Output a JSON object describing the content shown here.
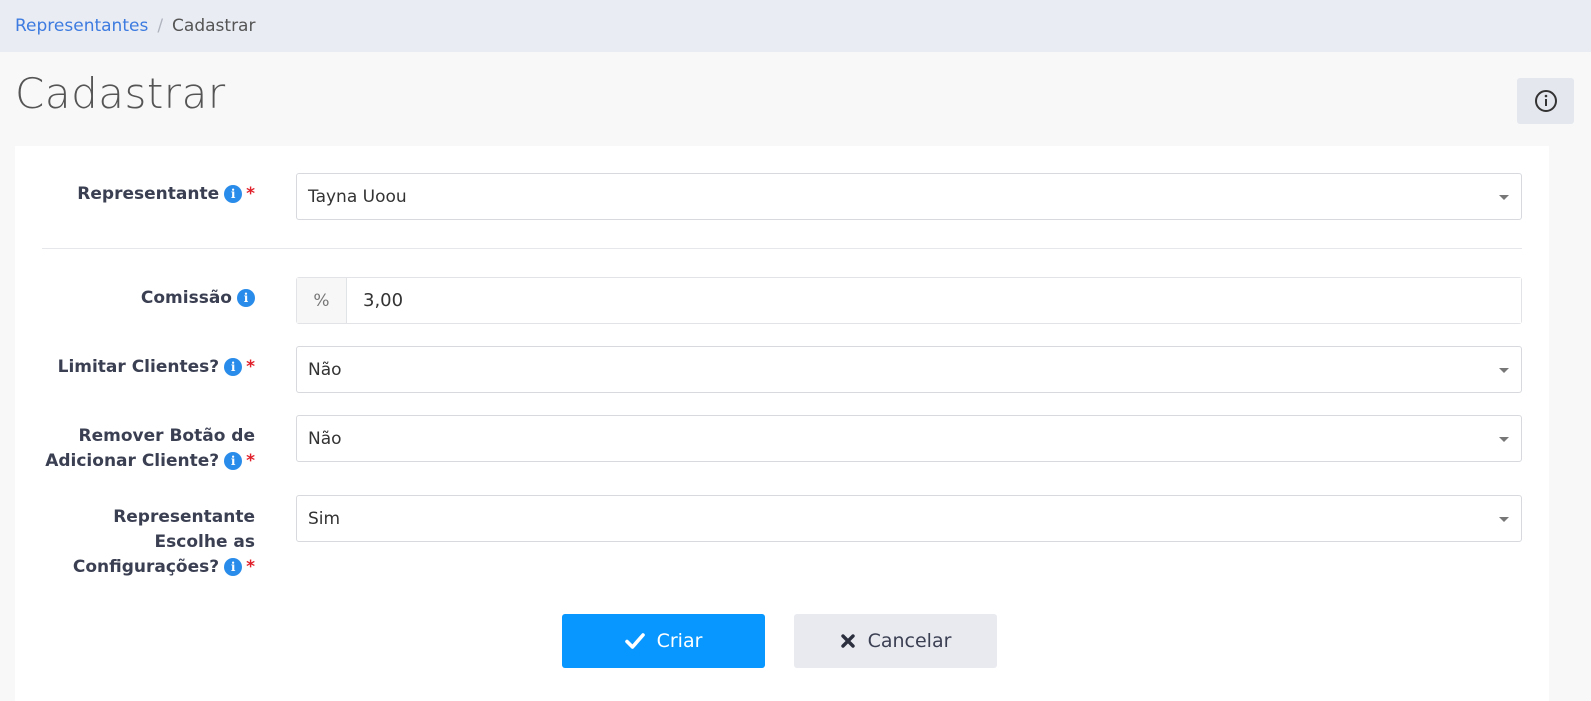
{
  "breadcrumb": {
    "parent": "Representantes",
    "separator": "/",
    "current": "Cadastrar"
  },
  "page": {
    "title": "Cadastrar"
  },
  "icons": {
    "tooltip": "i",
    "header_info": "info-circle-icon"
  },
  "form": {
    "representante": {
      "label": "Representante",
      "required": "*",
      "value": "Tayna Uoou"
    },
    "comissao": {
      "label": "Comissão",
      "addon": "%",
      "value": "3,00"
    },
    "limitar_clientes": {
      "label": "Limitar Clientes?",
      "required": "*",
      "value": "Não"
    },
    "remover_botao": {
      "label_line1": "Remover Botão de",
      "label_line2": "Adicionar Cliente?",
      "required": "*",
      "value": "Não"
    },
    "escolhe_config": {
      "label_line1": "Representante",
      "label_line2": "Escolhe as",
      "label_line3": "Configurações?",
      "required": "*",
      "value": "Sim"
    }
  },
  "buttons": {
    "criar": "Criar",
    "cancelar": "Cancelar"
  },
  "colors": {
    "primary": "#0797ff",
    "link": "#3d7be0",
    "required": "#e0202a",
    "tooltip": "#2a8cea"
  }
}
